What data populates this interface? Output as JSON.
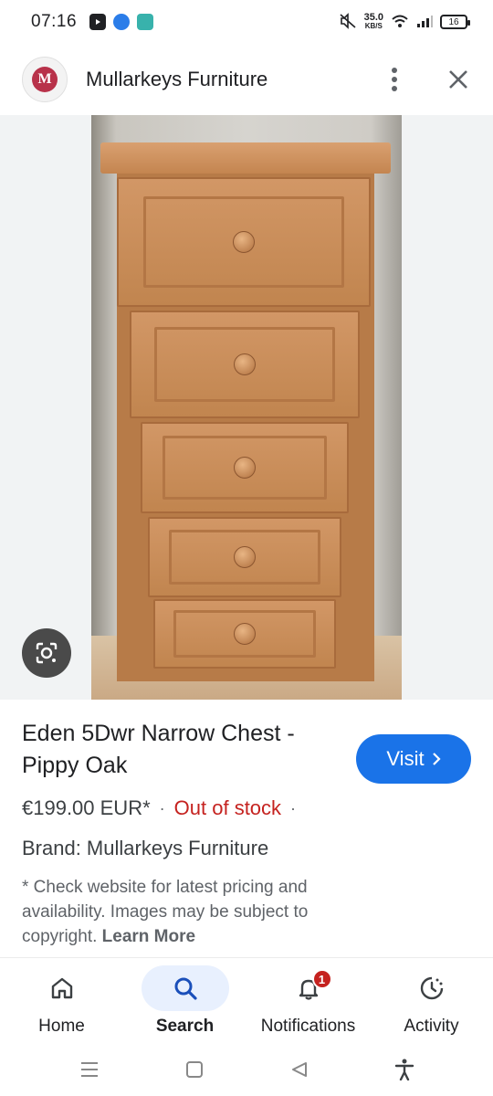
{
  "status_bar": {
    "time": "07:16",
    "net_speed_value": "35.0",
    "net_speed_unit": "KB/S",
    "battery": "16",
    "app_icons": [
      "youtube-icon",
      "messenger-icon",
      "chat-app-icon"
    ]
  },
  "header": {
    "site_name": "Mullarkeys Furniture",
    "logo_letter": "M"
  },
  "product": {
    "title": "Eden 5Dwr Narrow Chest - Pippy Oak",
    "price": "€199.00 EUR*",
    "separator": "·",
    "stock_status": "Out of stock",
    "brand": "Brand: Mullarkeys Furniture",
    "disclaimer": "* Check website for latest pricing and availability. Images may be subject to copyright.",
    "learn_more": "Learn More",
    "visit_label": "Visit"
  },
  "bottom_nav": {
    "items": [
      {
        "label": "Home",
        "icon": "home-icon",
        "active": false
      },
      {
        "label": "Search",
        "icon": "search-icon",
        "active": true
      },
      {
        "label": "Notifications",
        "icon": "bell-icon",
        "active": false,
        "badge": "1"
      },
      {
        "label": "Activity",
        "icon": "activity-icon",
        "active": false
      }
    ]
  },
  "colors": {
    "accent": "#1a73e8",
    "out_of_stock": "#c5221f",
    "active_tab_bg": "#e8f0fe"
  }
}
